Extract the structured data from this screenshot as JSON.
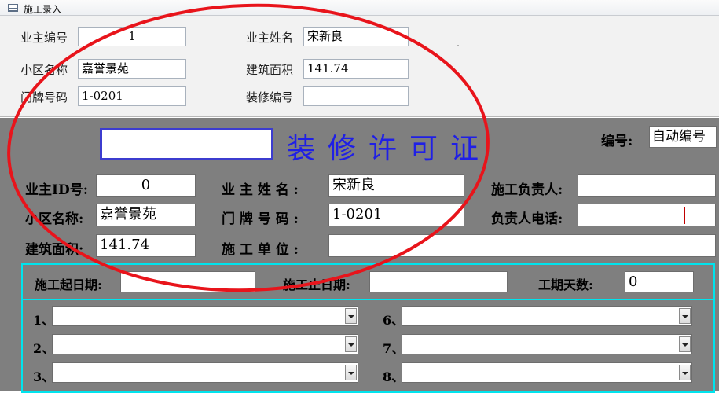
{
  "window": {
    "title": "施工录入"
  },
  "top": {
    "owner_no_label": "业主编号",
    "owner_no_value": "1",
    "owner_name_label": "业主姓名",
    "owner_name_value": "宋新良",
    "community_label": "小区名称",
    "community_value": "嘉誉景苑",
    "area_label": "建筑面积",
    "area_value": "141.74",
    "door_label": "门牌号码",
    "door_value": "1-0201",
    "decor_no_label": "装修编号",
    "decor_no_value": ""
  },
  "permit": {
    "title": "装修许可证",
    "number_label": "编号:",
    "number_value": "自动编号",
    "owner_id_label": "业主ID号:",
    "owner_id_value": "0",
    "owner_name_label": "业 主 姓 名 :",
    "owner_name_value": "宋新良",
    "manager_label": "施工负责人:",
    "manager_value": "",
    "community_label": "小区名称:",
    "community_value": "嘉誉景苑",
    "door_label": "门 牌 号 码 :",
    "door_value": "1-0201",
    "phone_label": "负责人电话:",
    "phone_value": "",
    "area_label": "建筑面积:",
    "area_value": "141.74",
    "company_label": "施 工 单 位 :",
    "company_value": ""
  },
  "schedule": {
    "start_label": "施工起日期:",
    "start_value": "",
    "end_label": "施工止日期:",
    "end_value": "",
    "days_label": "工期天数:",
    "days_value": "0"
  },
  "items": {
    "n1": "1、",
    "n2": "2、",
    "n3": "3、",
    "n6": "6、",
    "n7": "7、",
    "n8": "8、"
  },
  "annotation": {
    "color": "#e8141b"
  }
}
